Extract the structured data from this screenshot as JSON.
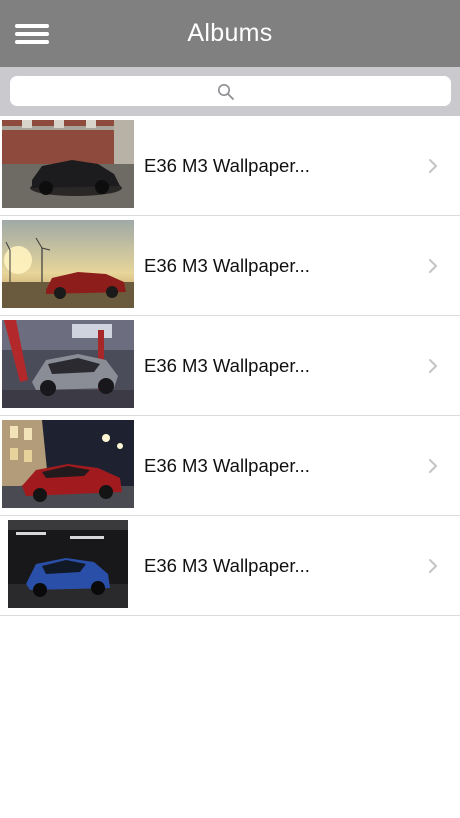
{
  "header": {
    "title": "Albums",
    "menu_icon": "hamburger-menu-icon"
  },
  "search": {
    "placeholder": "",
    "icon": "search-icon"
  },
  "albums": [
    {
      "label": "E36 M3 Wallpaper...",
      "icon": "chevron-right-icon"
    },
    {
      "label": "E36 M3 Wallpaper...",
      "icon": "chevron-right-icon"
    },
    {
      "label": "E36 M3 Wallpaper...",
      "icon": "chevron-right-icon"
    },
    {
      "label": "E36 M3 Wallpaper...",
      "icon": "chevron-right-icon"
    },
    {
      "label": "E36 M3 Wallpaper...",
      "icon": "chevron-right-icon"
    }
  ],
  "colors": {
    "header_bg": "#808080",
    "search_bar_bg": "#c9c9ce",
    "chevron": "#c4c4c7",
    "separator": "#dcdcdc"
  }
}
